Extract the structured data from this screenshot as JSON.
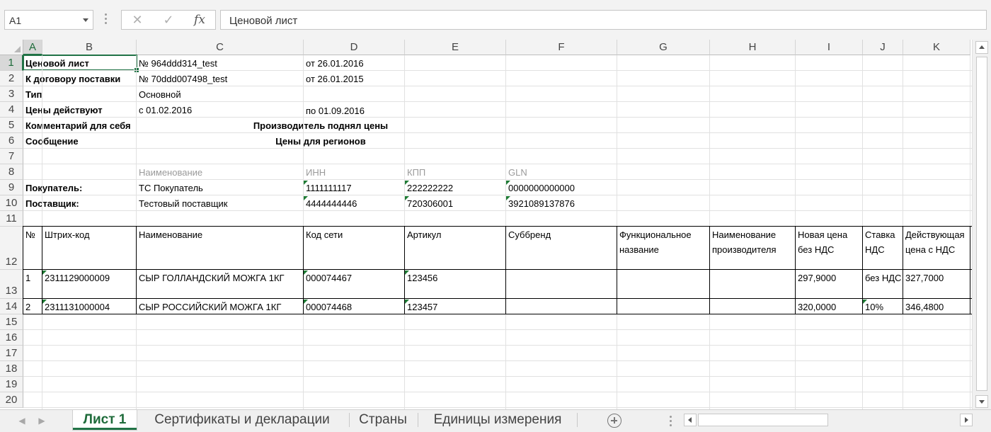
{
  "formula_bar": {
    "name_box": "A1",
    "cancel_icon": "✕",
    "enter_icon": "✓",
    "fx_label": "fx",
    "formula": "Ценовой лист"
  },
  "columns": [
    "A",
    "B",
    "C",
    "D",
    "E",
    "F",
    "G",
    "H",
    "I",
    "J",
    "K"
  ],
  "selected_column": "A",
  "rows": [
    "1",
    "2",
    "3",
    "4",
    "5",
    "6",
    "7",
    "8",
    "9",
    "10",
    "11",
    "12",
    "13",
    "14",
    "15",
    "16",
    "17",
    "18",
    "19",
    "20"
  ],
  "selected_row": "1",
  "header_block": {
    "r1": {
      "label": "Ценовой лист",
      "value": "№ 964ddd314_test",
      "date": "от 26.01.2016"
    },
    "r2": {
      "label": "К договору поставки",
      "value": "№ 70ddd007498_test",
      "date": "от 26.01.2015"
    },
    "r3": {
      "label": "Тип",
      "value": "Основной"
    },
    "r4": {
      "label": "Цены действуют",
      "value": "с 01.02.2016",
      "date": "по 01.09.2016"
    },
    "r5": {
      "label": "Комментарий для себя",
      "value": "Производитель поднял цены"
    },
    "r6": {
      "label": "Сообщение",
      "value": "Цены для регионов"
    }
  },
  "parties": {
    "headers": {
      "name": "Наименование",
      "inn": "ИНН",
      "kpp": "КПП",
      "gln": "GLN"
    },
    "buyer": {
      "label": "Покупатель:",
      "name": "ТС Покупатель",
      "inn": "1111111117",
      "kpp": "222222222",
      "gln": "0000000000000"
    },
    "supplier": {
      "label": "Поставщик:",
      "name": "Тестовый поставщик",
      "inn": "4444444446",
      "kpp": "720306001",
      "gln": "3921089137876"
    }
  },
  "table": {
    "headers": {
      "no": "№",
      "barcode": "Штрих-код",
      "name": "Наименование",
      "network_code": "Код сети",
      "article": "Артикул",
      "subbrand": "Суббренд",
      "functional_name": "Функциональное название",
      "manufacturer": "Наименование производителя",
      "new_price": "Новая цена без НДС",
      "vat_rate": "Ставка НДС",
      "current_price": "Действующая цена с НДС"
    },
    "rows": [
      {
        "no": "1",
        "barcode": "2311129000009",
        "name": "СЫР ГОЛЛАНДСКИЙ МОЖГА 1КГ",
        "network_code": "000074467",
        "article": "123456",
        "new_price": "297,9000",
        "vat_rate": "без НДС",
        "current_price": "327,7000"
      },
      {
        "no": "2",
        "barcode": "2311131000004",
        "name": "СЫР РОССИЙСКИЙ МОЖГА 1КГ",
        "network_code": "000074468",
        "article": "123457",
        "new_price": "320,0000",
        "vat_rate": "10%",
        "current_price": "346,4800"
      }
    ]
  },
  "sheet_tabs": {
    "tabs": [
      "Лист 1",
      "Сертификаты и декларации",
      "Страны",
      "Единицы измерения"
    ],
    "active": "Лист 1"
  },
  "colors": {
    "accent": "#217346",
    "error_triangle": "#1e7b34"
  }
}
